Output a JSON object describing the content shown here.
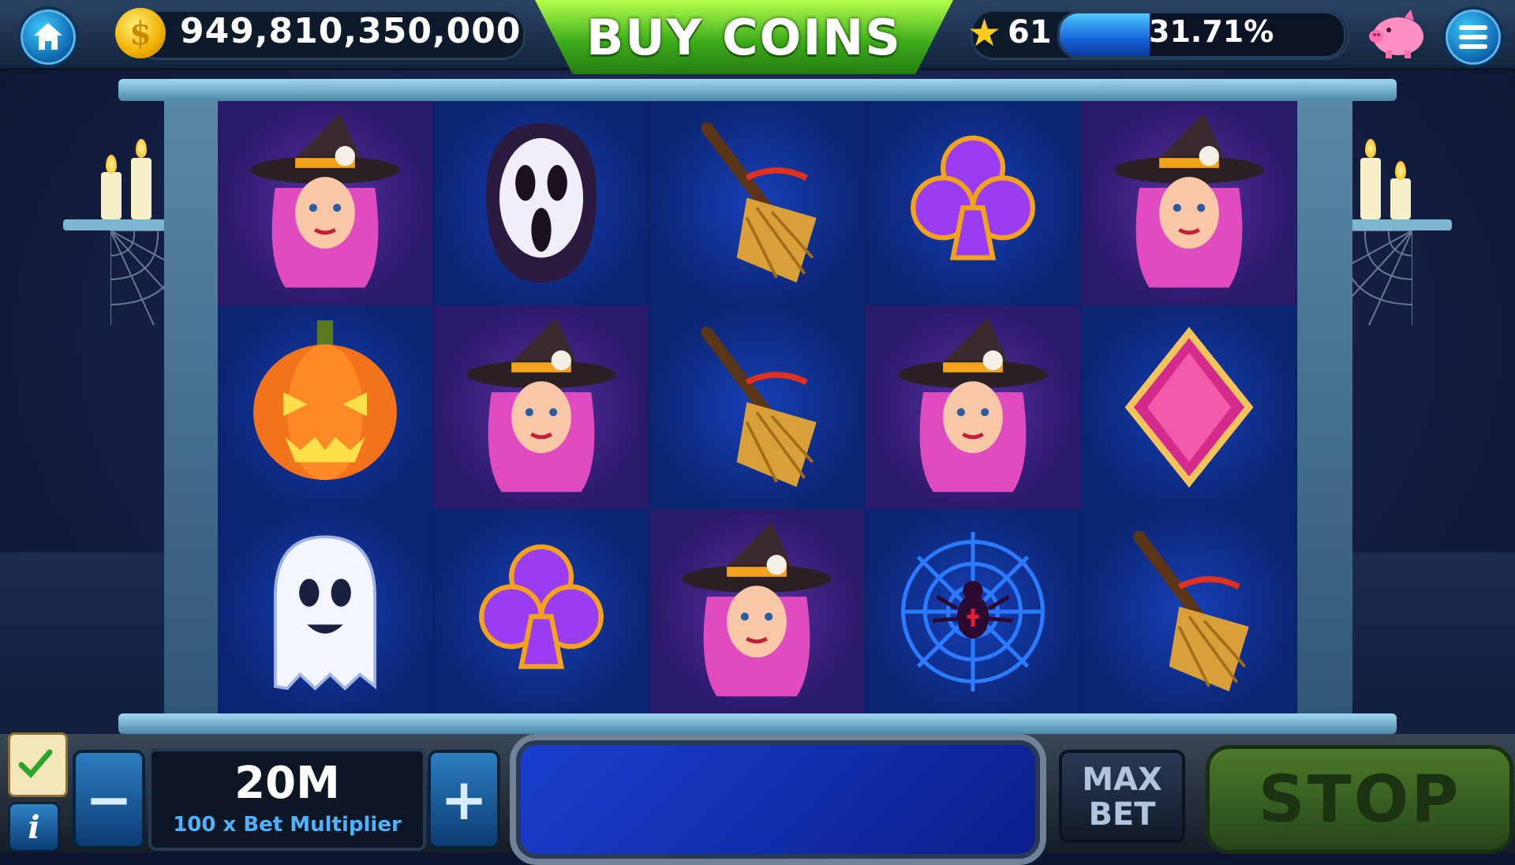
{
  "topbar": {
    "home_icon": "home-icon",
    "balance": "949,810,350,000",
    "buy_coins_label": "BUY COINS",
    "level": "61",
    "xp_percent_label": "31.71%",
    "xp_fraction": 0.3171,
    "piggy_icon": "piggy-bank-icon",
    "menu_icon": "hamburger-menu-icon"
  },
  "reels": {
    "rows": [
      [
        "witch",
        "ghost-mask",
        "broom",
        "club",
        "witch"
      ],
      [
        "pumpkin",
        "witch",
        "broom",
        "witch",
        "diamond"
      ],
      [
        "ghost",
        "club",
        "witch",
        "spider-web",
        "broom"
      ]
    ]
  },
  "bottombar": {
    "minus_label": "−",
    "bet_value": "20M",
    "bet_multiplier": "100 x Bet Multiplier",
    "plus_label": "+",
    "max_bet_line1": "MAX",
    "max_bet_line2": "BET",
    "stop_label": "STOP",
    "info_label": "i"
  },
  "colors": {
    "buy_coins_green": "#3fae1c",
    "xp_blue": "#1565d8",
    "reel_blue": "#0d2a7a",
    "witch_hair": "#e04bbf",
    "stop_green": "#4b7a2a"
  }
}
